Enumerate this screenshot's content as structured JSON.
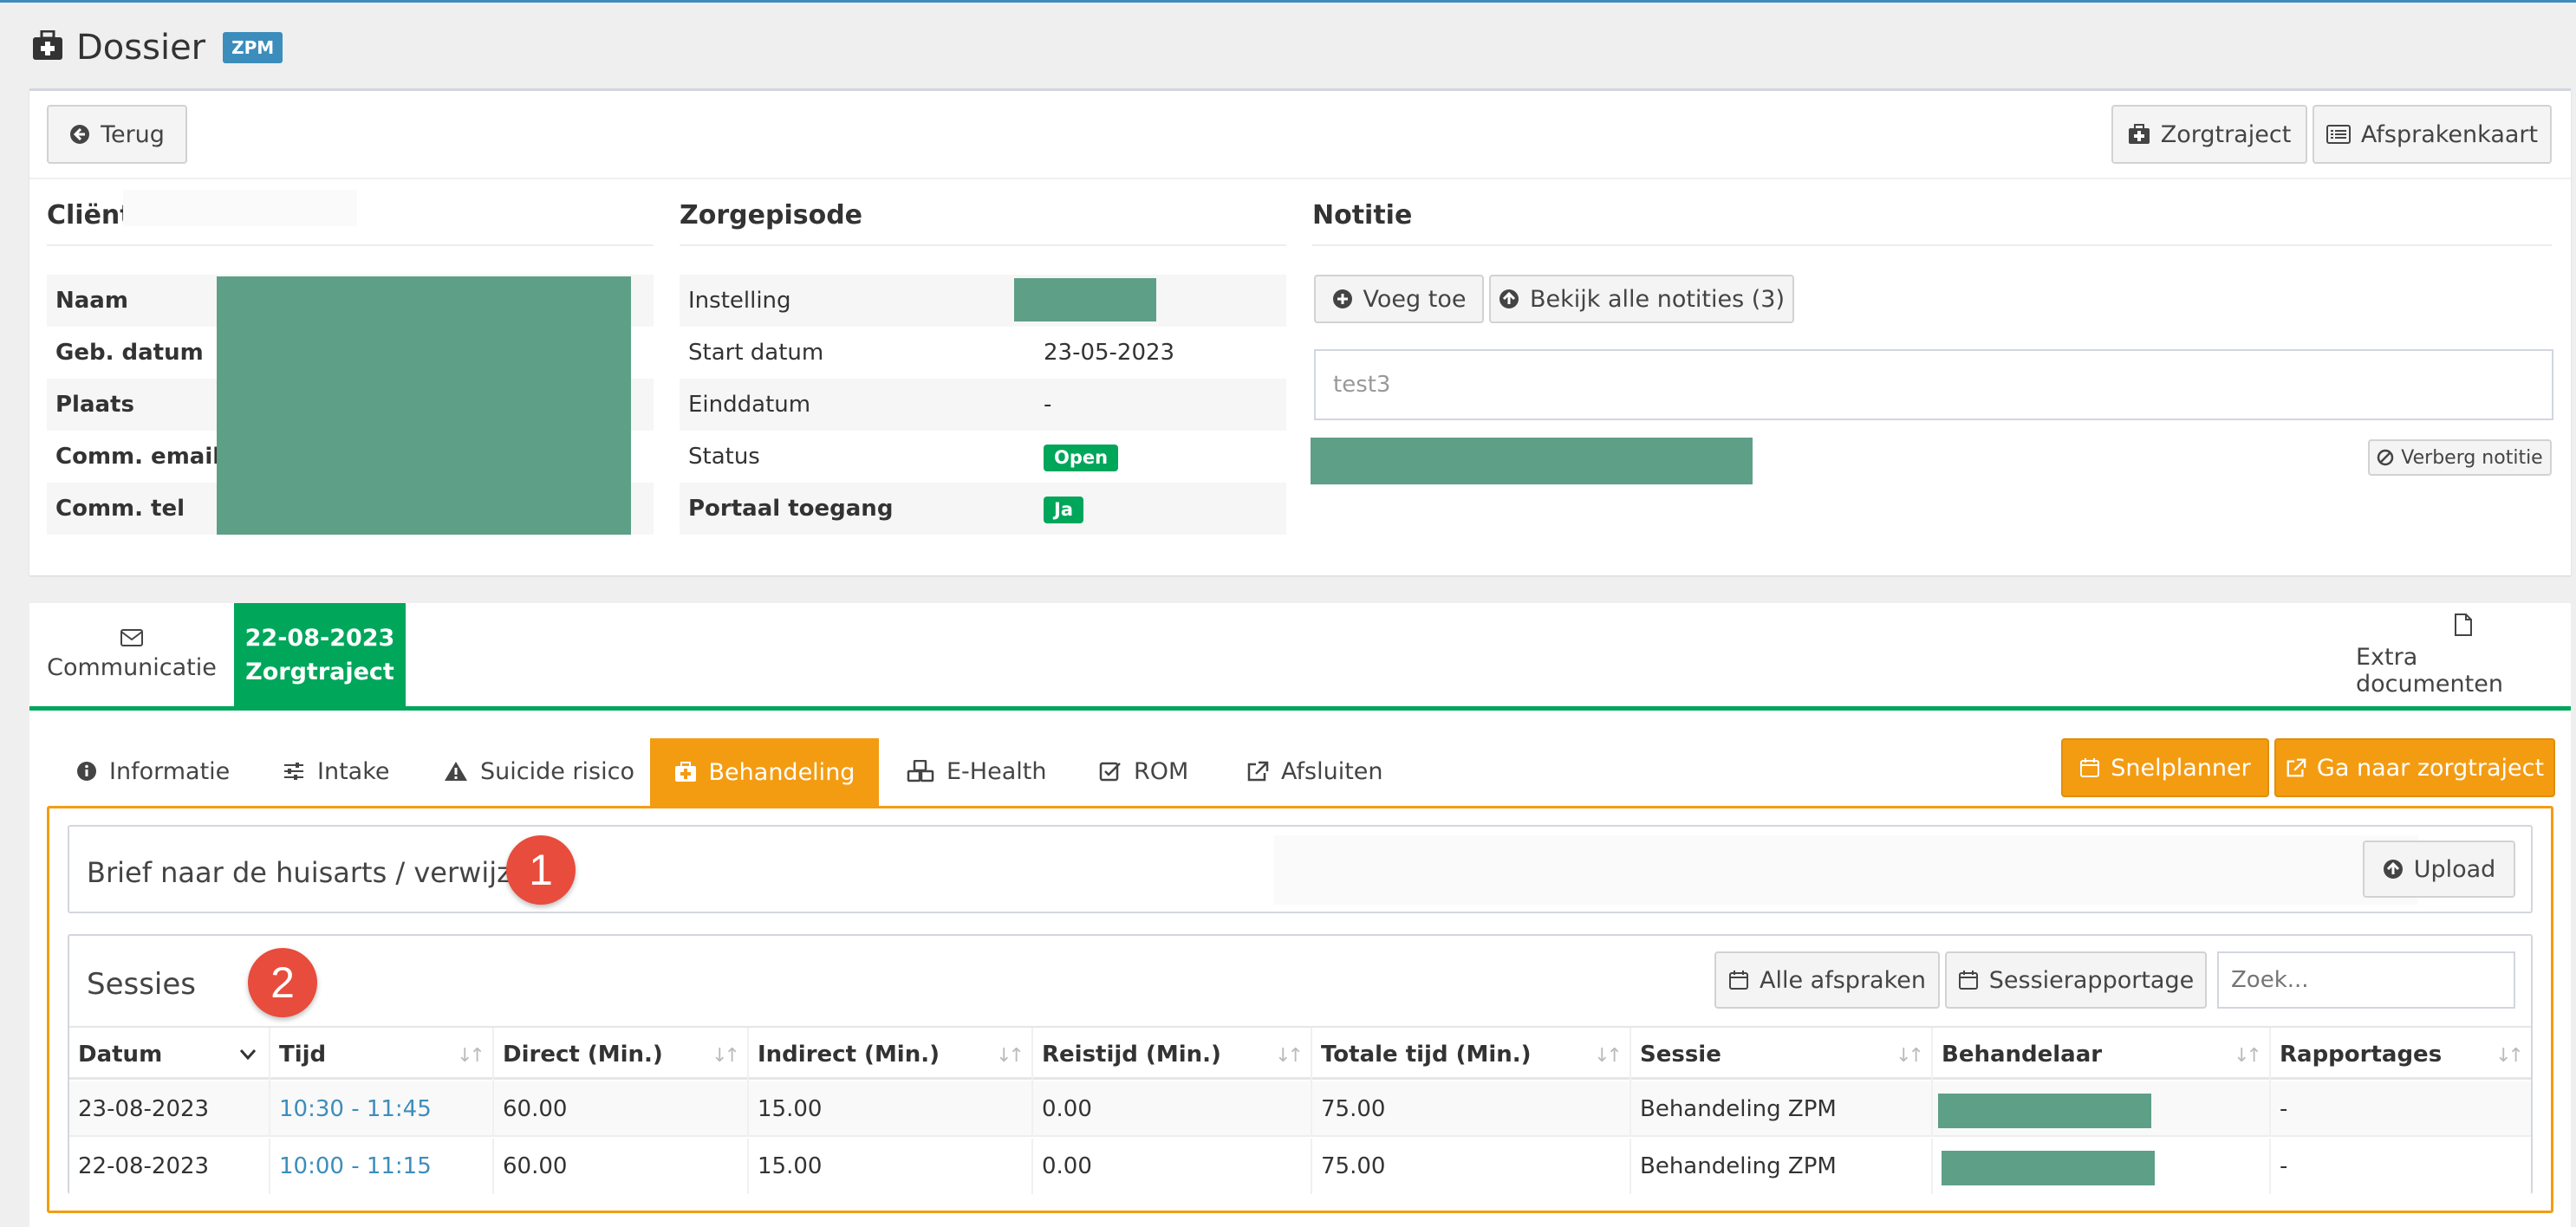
{
  "page": {
    "title": "Dossier",
    "badge": "ZPM"
  },
  "toolbar": {
    "back": "Terug",
    "zorgtraject": "Zorgtraject",
    "afsprakenkaart": "Afsprakenkaart"
  },
  "client": {
    "title": "Cliënt",
    "rows": [
      {
        "label": "Naam"
      },
      {
        "label": "Geb. datum"
      },
      {
        "label": "Plaats"
      },
      {
        "label": "Comm. email"
      },
      {
        "label": "Comm. tel"
      }
    ]
  },
  "episode": {
    "title": "Zorgepisode",
    "instelling_label": "Instelling",
    "start_label": "Start datum",
    "start_value": "23-05-2023",
    "eind_label": "Einddatum",
    "eind_value": "-",
    "status_label": "Status",
    "status_value": "Open",
    "portaal_label": "Portaal toegang",
    "portaal_value": "Ja"
  },
  "notes": {
    "title": "Notitie",
    "add": "Voeg toe",
    "view_all": "Bekijk alle notities (3)",
    "placeholder": "test3",
    "hide": "Verberg notitie"
  },
  "main_tabs": {
    "communicatie": "Communicatie",
    "zorgtraject_date": "22-08-2023",
    "zorgtraject_label": "Zorgtraject",
    "extra": "Extra documenten"
  },
  "sub_tabs": {
    "informatie": "Informatie",
    "intake": "Intake",
    "suicide": "Suicide risico",
    "behandeling": "Behandeling",
    "ehealth": "E-Health",
    "rom": "ROM",
    "afsluiten": "Afsluiten"
  },
  "actions": {
    "snelplanner": "Snelplanner",
    "ga_naar": "Ga naar zorgtraject"
  },
  "brief": {
    "title": "Brief naar de huisarts / verwijzer",
    "upload": "Upload",
    "marker": "1"
  },
  "sessies": {
    "title": "Sessies",
    "marker": "2",
    "alle_afspraken": "Alle afspraken",
    "sessierapportage": "Sessierapportage",
    "search_placeholder": "Zoek...",
    "columns": [
      "Datum",
      "Tijd",
      "Direct (Min.)",
      "Indirect (Min.)",
      "Reistijd (Min.)",
      "Totale tijd (Min.)",
      "Sessie",
      "Behandelaar",
      "Rapportages"
    ],
    "rows": [
      {
        "datum": "23-08-2023",
        "tijd": "10:30 - 11:45",
        "direct": "60.00",
        "indirect": "15.00",
        "reistijd": "0.00",
        "totaal": "75.00",
        "sessie": "Behandeling ZPM",
        "rapportages": "-"
      },
      {
        "datum": "22-08-2023",
        "tijd": "10:00 - 11:15",
        "direct": "60.00",
        "indirect": "15.00",
        "reistijd": "0.00",
        "totaal": "75.00",
        "sessie": "Behandeling ZPM",
        "rapportages": "-"
      }
    ]
  },
  "colors": {
    "accent_green": "#00a65a",
    "orange": "#f39c12",
    "redaction": "#5e9f87",
    "link": "#3c8dbc",
    "marker": "#e74c3c"
  }
}
